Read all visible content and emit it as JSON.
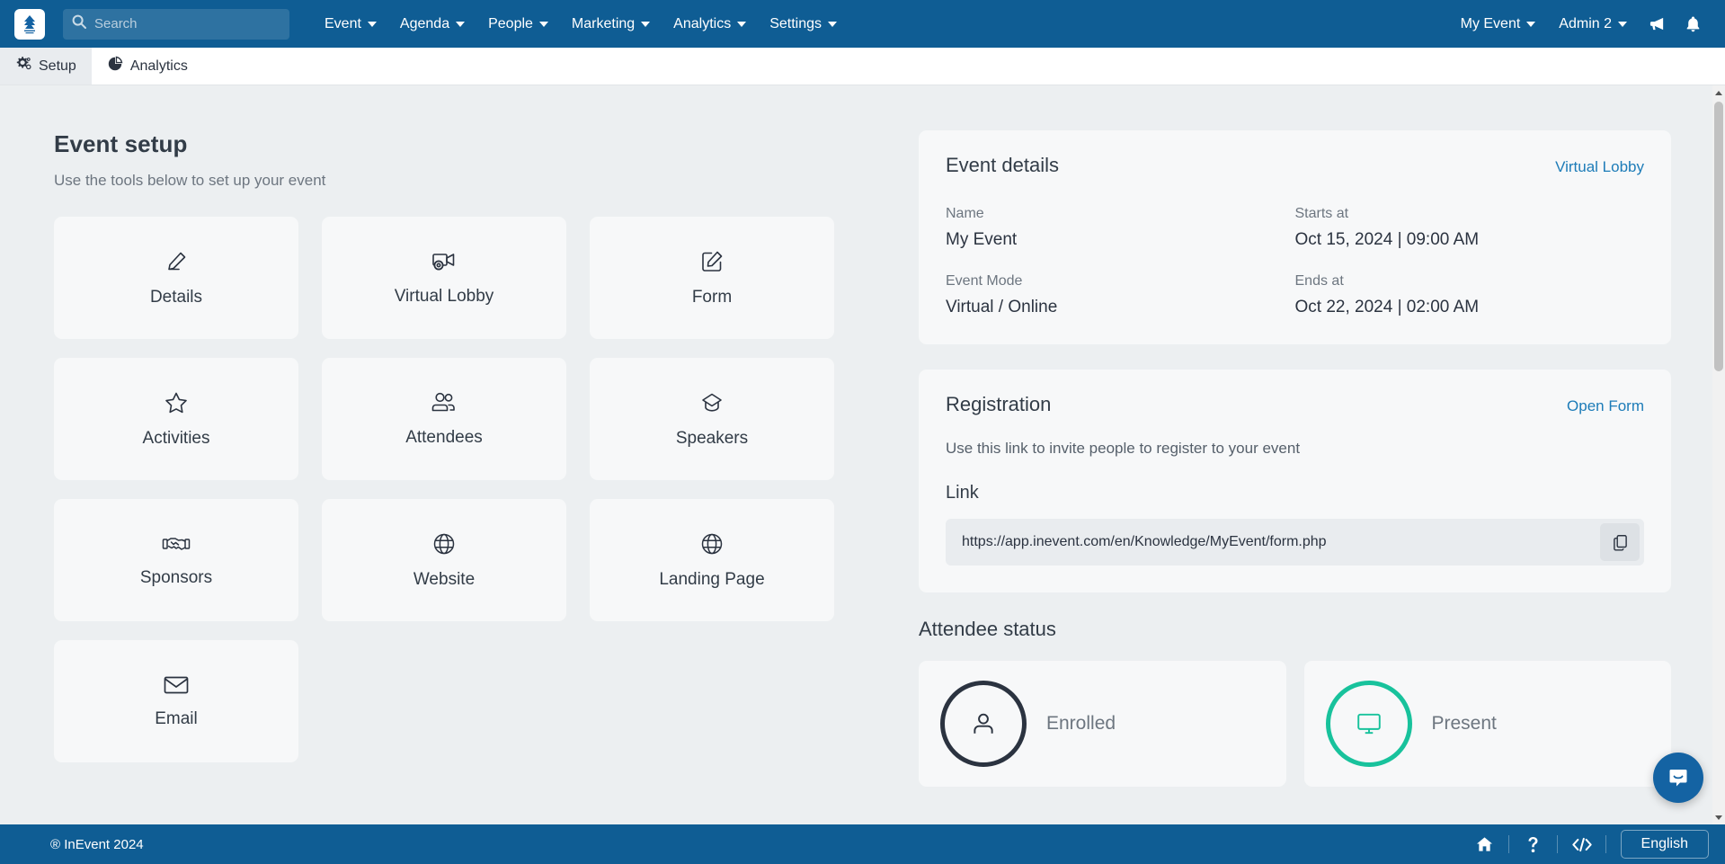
{
  "colors": {
    "brand_blue": "#0f5d94",
    "link_blue": "#1d7cb8",
    "accent_green": "#18c29c",
    "dark_ring": "#2b3340",
    "page_bg": "#eceff1",
    "panel_bg": "#f7f8f9"
  },
  "topnav": {
    "logo_icon": "inevent-logo-icon",
    "search_placeholder": "Search",
    "search_value": "",
    "search_icon": "search-icon",
    "menu": [
      {
        "label": "Event",
        "icon": "chevron-down-icon"
      },
      {
        "label": "Agenda",
        "icon": "chevron-down-icon"
      },
      {
        "label": "People",
        "icon": "chevron-down-icon"
      },
      {
        "label": "Marketing",
        "icon": "chevron-down-icon"
      },
      {
        "label": "Analytics",
        "icon": "chevron-down-icon"
      },
      {
        "label": "Settings",
        "icon": "chevron-down-icon"
      }
    ],
    "event_switcher": "My Event",
    "account": "Admin 2",
    "announcement_icon": "megaphone-icon",
    "notifications_icon": "bell-icon"
  },
  "tabstrip": {
    "tabs": [
      {
        "label": "Setup",
        "icon": "gears-icon",
        "active": true
      },
      {
        "label": "Analytics",
        "icon": "pie-chart-icon",
        "active": false
      }
    ]
  },
  "setup": {
    "title": "Event setup",
    "subtitle": "Use the tools below to set up your event",
    "tiles": [
      {
        "label": "Details",
        "icon": "pencil-icon"
      },
      {
        "label": "Virtual Lobby",
        "icon": "video-camera-gear-icon"
      },
      {
        "label": "Form",
        "icon": "form-edit-icon"
      },
      {
        "label": "Activities",
        "icon": "star-icon"
      },
      {
        "label": "Attendees",
        "icon": "people-icon"
      },
      {
        "label": "Speakers",
        "icon": "graduation-cap-icon"
      },
      {
        "label": "Sponsors",
        "icon": "handshake-icon"
      },
      {
        "label": "Website",
        "icon": "globe-icon"
      },
      {
        "label": "Landing Page",
        "icon": "globe-icon"
      },
      {
        "label": "Email",
        "icon": "envelope-icon"
      }
    ]
  },
  "event_details": {
    "title": "Event details",
    "link_label": "Virtual Lobby",
    "fields": [
      {
        "label": "Name",
        "value": "My Event"
      },
      {
        "label": "Starts at",
        "value": "Oct 15, 2024 | 09:00 AM"
      },
      {
        "label": "Event Mode",
        "value": "Virtual / Online"
      },
      {
        "label": "Ends at",
        "value": "Oct 22, 2024 | 02:00 AM"
      }
    ]
  },
  "registration": {
    "title": "Registration",
    "link_label": "Open Form",
    "description": "Use this link to invite people to register to your event",
    "link_field_label": "Link",
    "url": "https://app.inevent.com/en/Knowledge/MyEvent/form.php",
    "copy_icon": "copy-icon"
  },
  "attendee_status": {
    "title": "Attendee status",
    "cards": [
      {
        "label": "Enrolled",
        "icon": "person-icon",
        "color": "#2b3340"
      },
      {
        "label": "Present",
        "icon": "monitor-icon",
        "color": "#18c29c"
      }
    ]
  },
  "footer": {
    "copyright": "® InEvent 2024",
    "icons": [
      {
        "name": "home-icon"
      },
      {
        "name": "help-question-icon"
      },
      {
        "name": "code-icon"
      }
    ],
    "language": "English"
  },
  "chat": {
    "icon": "intercom-chat-icon"
  },
  "scrollbar": {
    "up_icon": "scroll-up-arrow-icon",
    "down_icon": "scroll-down-arrow-icon"
  }
}
